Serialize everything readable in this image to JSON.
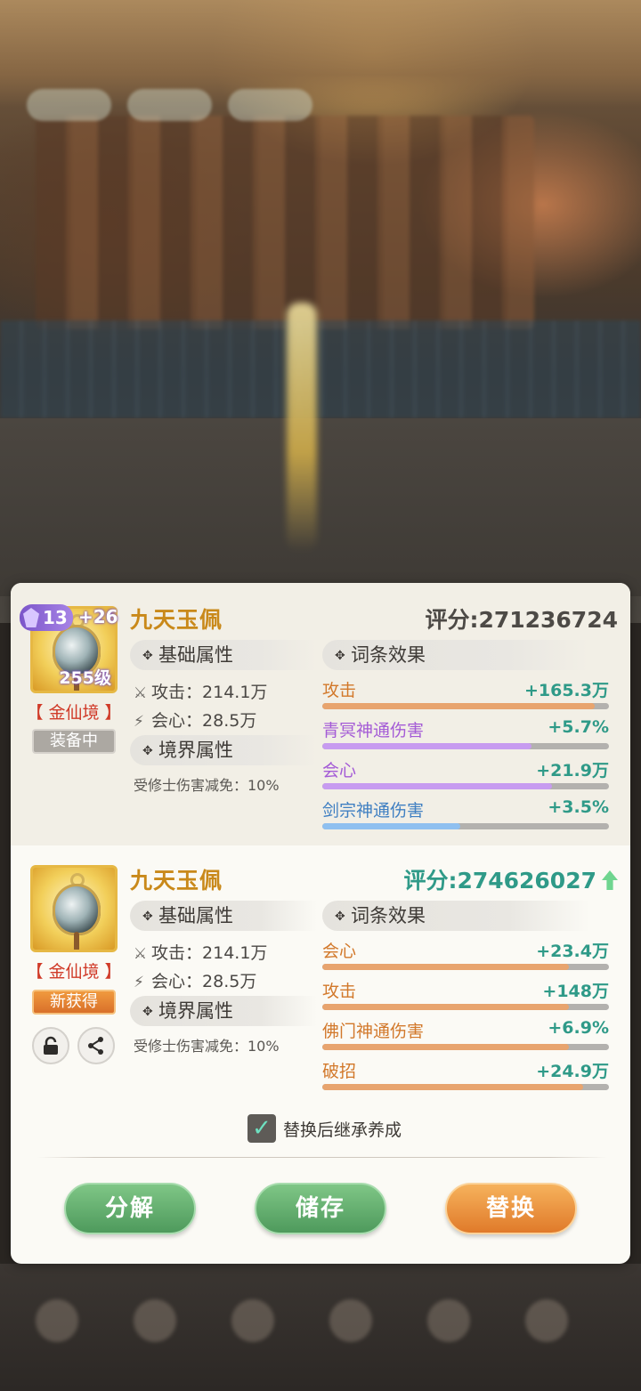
{
  "colors": {
    "name_gold": "#c9891a",
    "realm_red": "#d03a28",
    "score_green": "#2f9a88",
    "attack_bar": "#e8a46e",
    "purple_bar": "#c79bf0",
    "blue_bar": "#8fc0f0",
    "orange_value": "#d2782a",
    "green_value": "#2f9a88",
    "button_green": "#5aa866",
    "button_orange": "#ec8f3a"
  },
  "current": {
    "gem_level": "13",
    "plus": "+26",
    "item_level": "255级",
    "realm": "【 金仙境 】",
    "status": "装备中",
    "name": "九天玉佩",
    "score_label": "评分:",
    "score_value": "271236724",
    "base_header": "基础属性",
    "affix_header": "词条效果",
    "realm_header": "境界属性",
    "stats": [
      {
        "label": "攻击：",
        "value": "214.1万"
      },
      {
        "label": "会心：",
        "value": "28.5万"
      }
    ],
    "realm_stat": "受修士伤害减免：10%",
    "affixes": [
      {
        "name": "攻击",
        "value": "+165.3万",
        "fill": 0.95,
        "color": "orange"
      },
      {
        "name": "青冥神通伤害",
        "value": "+5.7%",
        "fill": 0.73,
        "color": "purple"
      },
      {
        "name": "会心",
        "value": "+21.9万",
        "fill": 0.8,
        "color": "purple"
      },
      {
        "name": "剑宗神通伤害",
        "value": "+3.5%",
        "fill": 0.48,
        "color": "blue"
      }
    ]
  },
  "new": {
    "realm": "【 金仙境 】",
    "status": "新获得",
    "name": "九天玉佩",
    "score_label": "评分:",
    "score_value": "274626027",
    "score_trend": "up",
    "base_header": "基础属性",
    "affix_header": "词条效果",
    "realm_header": "境界属性",
    "stats": [
      {
        "label": "攻击：",
        "value": "214.1万"
      },
      {
        "label": "会心：",
        "value": "28.5万"
      }
    ],
    "realm_stat": "受修士伤害减免：10%",
    "affixes": [
      {
        "name": "会心",
        "value": "+23.4万",
        "fill": 0.86,
        "color": "orange"
      },
      {
        "name": "攻击",
        "value": "+148万",
        "fill": 0.86,
        "color": "orange"
      },
      {
        "name": "佛门神通伤害",
        "value": "+6.9%",
        "fill": 0.86,
        "color": "orange"
      },
      {
        "name": "破招",
        "value": "+24.9万",
        "fill": 0.91,
        "color": "orange"
      }
    ],
    "lock_icon": "lock-icon",
    "share_icon": "share-icon"
  },
  "inherit_checkbox": {
    "checked": true,
    "label": "替换后继承养成"
  },
  "buttons": {
    "decompose": "分解",
    "store": "储存",
    "replace": "替换"
  }
}
